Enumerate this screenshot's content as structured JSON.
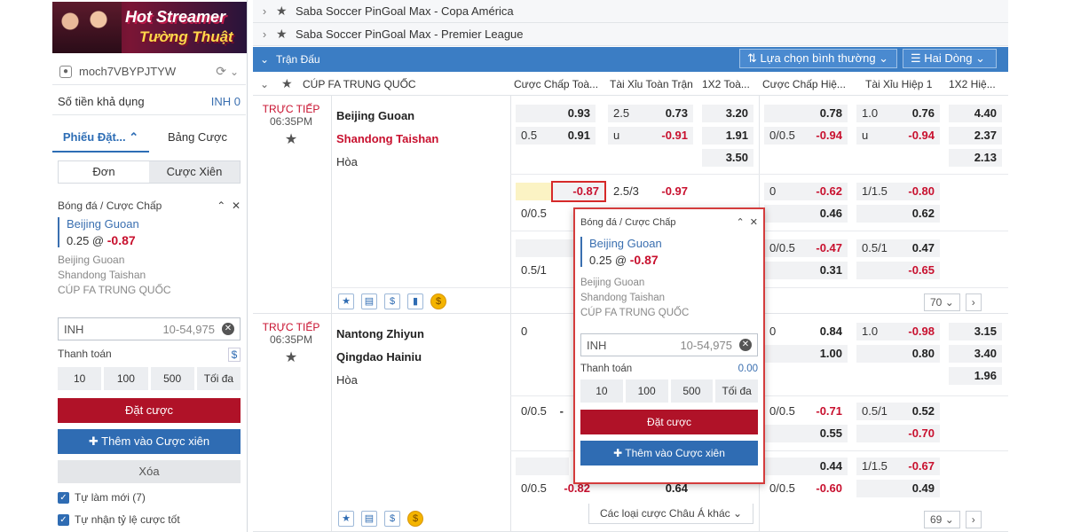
{
  "banner": {
    "line1": "Hot Streamer",
    "line2": "Tường Thuật"
  },
  "user": {
    "name": "moch7VBYPJTYW"
  },
  "balance": {
    "label": "Số tiền khả dụng",
    "value": "INH 0"
  },
  "panel_tabs": [
    "Phiếu Đặt...",
    "Bảng Cược"
  ],
  "bet_type_tabs": [
    "Đơn",
    "Cược Xiên"
  ],
  "slip": {
    "market": "Bóng đá / Cược Chấp",
    "pick": "Beijing Guoan",
    "line": "0.25 @",
    "odds": "-0.87",
    "home": "Beijing Guoan",
    "away": "Shandong Taishan",
    "league": "CÚP FA TRUNG QUỐC",
    "currency": "INH",
    "range": "10-54,975",
    "payout_label": "Thanh toán",
    "payout_value": "0.00",
    "chips": [
      "10",
      "100",
      "500",
      "Tối đa"
    ],
    "place_bet": "Đặt cược",
    "add_parlay": "Thêm vào Cược xiên",
    "clear": "Xóa",
    "auto_refresh": "Tự làm mới (7)",
    "auto_accept": "Tự nhận tỷ lệ cược tốt"
  },
  "leagues": [
    "Saba Soccer PinGoal Max - Copa América",
    "Saba Soccer PinGoal Max - Premier League"
  ],
  "header": {
    "title": "Trận Đấu",
    "sort": "Lựa chọn bình thường",
    "view": "Hai Dòng"
  },
  "columns": {
    "league": "CÚP FA TRUNG QUỐC",
    "c1": "Cược Chấp Toà...",
    "c2": "Tài Xỉu Toàn Trận",
    "c3": "1X2 Toà...",
    "c4": "Cược Chấp Hiệ...",
    "c5": "Tài Xỉu Hiệp 1",
    "c6": "1X2 Hiệ..."
  },
  "matches": [
    {
      "status": "TRỰC TIẾP",
      "time": "06:35PM",
      "home": "Beijing Guoan",
      "away": "Shandong Taishan",
      "draw": "Hòa",
      "more": "70"
    },
    {
      "status": "TRỰC TIẾP",
      "time": "06:35PM",
      "home": "Nantong Zhiyun",
      "away": "Qingdao Hainiu",
      "draw": "Hòa",
      "more": "69"
    }
  ],
  "odds": {
    "m1r1": {
      "hdp": [
        "",
        "0.93",
        "0.5",
        "0.91"
      ],
      "ou": [
        "2.5",
        "0.73",
        "u",
        "-0.91"
      ],
      "x12": [
        "3.20",
        "1.91",
        "3.50"
      ],
      "hhdp": [
        "",
        "0.78",
        "0/0.5",
        "-0.94"
      ],
      "hou": [
        "1.0",
        "0.76",
        "u",
        "-0.94"
      ],
      "hx12": [
        "4.40",
        "2.37",
        "2.13"
      ]
    },
    "m1r2": {
      "hdp": [
        "",
        "-0.87",
        "0/0.5",
        ""
      ],
      "ou": [
        "2.5/3",
        "-0.97"
      ],
      "hhdp": [
        "0",
        "-0.62",
        "",
        "0.46"
      ],
      "hou": [
        "1/1.5",
        "-0.80",
        "",
        "0.62"
      ]
    },
    "m1r3": {
      "hdp": [
        "0.5/1",
        ""
      ],
      "hhdp": [
        "0/0.5",
        "-0.47",
        "",
        "0.31"
      ],
      "hou": [
        "0.5/1",
        "0.47",
        "",
        "-0.65"
      ]
    },
    "m2r1": {
      "hdp": [
        "0",
        ""
      ],
      "hhdp": [
        "0",
        "0.84",
        "",
        "1.00"
      ],
      "hou": [
        "1.0",
        "-0.98",
        "",
        "0.80"
      ],
      "hx12": [
        "3.15",
        "3.40",
        "1.96"
      ]
    },
    "m2r2": {
      "hdp": [
        "0/0.5",
        "-"
      ],
      "hhdp": [
        "0/0.5",
        "-0.71",
        "",
        "0.55"
      ],
      "hou": [
        "0.5/1",
        "0.52",
        "",
        "-0.70"
      ]
    },
    "m2r3": {
      "hdp": [
        "0/0.5",
        "-0.82"
      ],
      "ou": [
        "",
        "0.64"
      ],
      "hhdp": [
        "",
        "0.44",
        "0/0.5",
        "-0.60"
      ],
      "hou": [
        "1/1.5",
        "-0.67",
        "",
        "0.49"
      ]
    }
  },
  "more_bets": "Các loại cược Châu Á khác"
}
